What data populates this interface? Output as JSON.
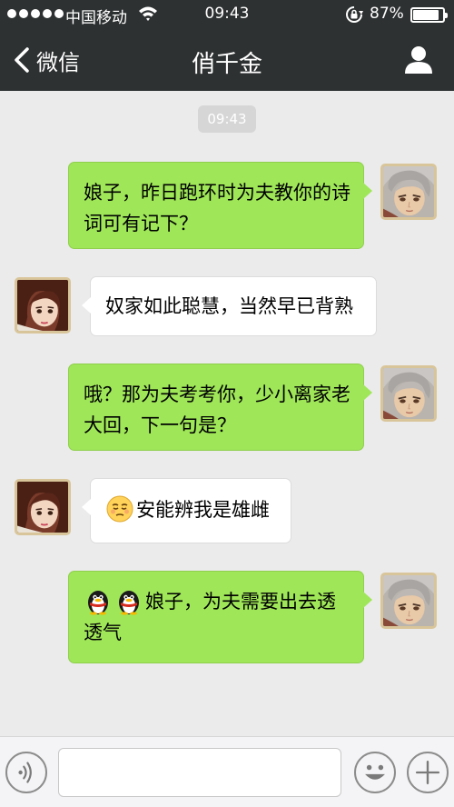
{
  "status_bar": {
    "carrier": "中国移动",
    "time": "09:43",
    "battery_percent": "87%",
    "battery_level": 0.87
  },
  "nav": {
    "back_label": "微信",
    "title": "俏千金",
    "profile_icon": "user-icon"
  },
  "chat": {
    "timestamp": "09:43",
    "messages": [
      {
        "side": "out",
        "text": "娘子，昨日跑环时为夫教你的诗词可有记下？"
      },
      {
        "side": "in",
        "text": "奴家如此聪慧，当然早已背熟"
      },
      {
        "side": "out",
        "text": "哦？那为夫考考你，少小离家老大回，下一句是？"
      },
      {
        "side": "in",
        "emoji": [
          "smirk-face-emoji"
        ],
        "text": "安能辨我是雄雌"
      },
      {
        "side": "out",
        "emoji": [
          "penguin-emoji",
          "penguin-emoji"
        ],
        "text": "娘子，为夫需要出去透透气"
      }
    ]
  },
  "input_bar": {
    "value": "",
    "placeholder": "",
    "voice_icon": "voice-icon",
    "emoji_icon": "smiley-face-icon",
    "add_icon": "plus-icon"
  },
  "colors": {
    "nav_bg": "#2e3132",
    "chat_bg": "#ebebeb",
    "outgoing_bubble": "#9fe658",
    "incoming_bubble": "#ffffff"
  }
}
